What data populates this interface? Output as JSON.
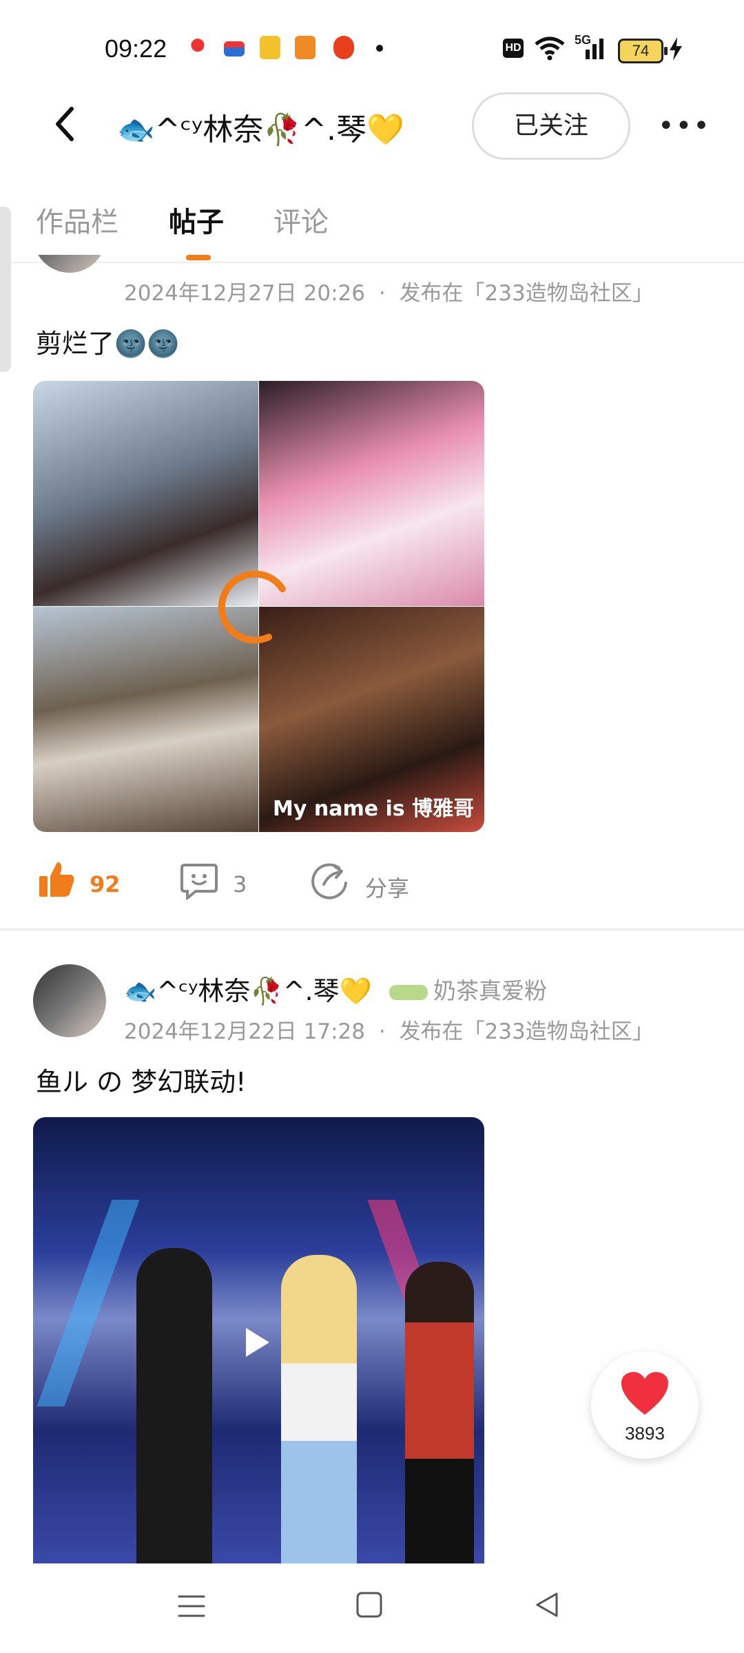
{
  "status_bar": {
    "time": "09:22",
    "battery": "74",
    "network": "5G",
    "hd_label": "HD",
    "icons": [
      "map-pin-icon",
      "card-icon",
      "book-icon",
      "app-icon",
      "app-red-icon",
      "dot-icon",
      "hd-icon",
      "wifi-icon",
      "signal-icon",
      "battery-icon",
      "charging-icon"
    ]
  },
  "header": {
    "profile_name": "🐟^ᶜʸ林奈🥀^.琴💛",
    "follow_label": "已关注",
    "more_label": "•••"
  },
  "tabs": [
    {
      "label": "作品栏",
      "active": false
    },
    {
      "label": "帖子",
      "active": true
    },
    {
      "label": "评论",
      "active": false
    }
  ],
  "posts": [
    {
      "date": "2024年12月27日 20:26",
      "separator": "·",
      "published_in": "发布在「233造物岛社区」",
      "text": "剪烂了🌚🌚",
      "image_caption": "My name is 博雅哥",
      "likes": "92",
      "comments": "3",
      "share_label": "分享"
    },
    {
      "author": "🐟^ᶜʸ林奈🥀^.琴💛",
      "badge": "奶茶真爱粉",
      "date": "2024年12月22日 17:28",
      "separator": "·",
      "published_in": "发布在「233造物岛社区」",
      "text": "鱼ル の 梦幻联动!"
    }
  ],
  "floating": {
    "favorites_count": "3893"
  },
  "colors": {
    "accent": "#f07d1a",
    "like": "#f07d1a",
    "heart": "#f0303c"
  }
}
